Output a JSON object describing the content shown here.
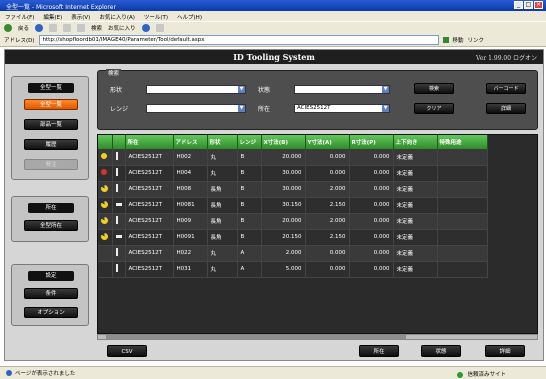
{
  "window": {
    "title": "全型一覧 - Microsoft Internet Explorer"
  },
  "menu": [
    "ファイル(F)",
    "編集(E)",
    "表示(V)",
    "お気に入り(A)",
    "ツール(T)",
    "ヘルプ(H)"
  ],
  "toolbar": {
    "back": "戻る",
    "search": "検索",
    "favorites": "お気に入り"
  },
  "address": {
    "label": "アドレス(D)",
    "url": "http://shopfloordb01/IMAGE40/Parameter/Tool/default.aspx",
    "go": "移動",
    "links": "リンク"
  },
  "app": {
    "title": "ID Tooling System",
    "version": "Ver 1.99.00",
    "logout": "ログオン"
  },
  "left": {
    "panel1": {
      "top": "全型一覧",
      "items": [
        "全型一覧",
        "部品一覧",
        "履歴",
        "発注"
      ]
    },
    "panel2": {
      "head": "所在",
      "item": "全型所在"
    },
    "panel3": {
      "head": "設定",
      "items": [
        "条件",
        "オプション"
      ]
    }
  },
  "search": {
    "legend": "検索",
    "shape_label": "形状",
    "shape_value": "",
    "state_label": "状態",
    "state_value": "",
    "range_label": "レンジ",
    "range_value": "",
    "location_label": "所在",
    "location_value": "ACIES2512T",
    "btn_search": "検索",
    "btn_barcode": "バーコード",
    "btn_clear": "クリア",
    "btn_detail": "詳細"
  },
  "table": {
    "headers": [
      "",
      "",
      "所在",
      "アドレス",
      "形状",
      "レンジ",
      "X寸法(B)",
      "Y寸法(A)",
      "R寸法(P)",
      "上下向き",
      "特殊用途"
    ],
    "rows": [
      {
        "status": "dot",
        "tool": "t",
        "loc": "ACIES2512T",
        "addr": "H002",
        "shape": "丸",
        "range": "B",
        "x": "20.000",
        "y": "0.000",
        "r": "0.000",
        "ud": "未定義",
        "sp": ""
      },
      {
        "status": "red",
        "tool": "t",
        "loc": "ACIES2512T",
        "addr": "H004",
        "shape": "丸",
        "range": "B",
        "x": "30.000",
        "y": "0.000",
        "r": "0.000",
        "ud": "未定義",
        "sp": ""
      },
      {
        "status": "pac",
        "tool": "t",
        "loc": "ACIES2512T",
        "addr": "H008",
        "shape": "長角",
        "range": "B",
        "x": "30.000",
        "y": "2.000",
        "r": "0.000",
        "ud": "未定義",
        "sp": ""
      },
      {
        "status": "pac",
        "tool": "flat",
        "loc": "ACIES2512T",
        "addr": "H0081",
        "shape": "長角",
        "range": "B",
        "x": "30.150",
        "y": "2.150",
        "r": "0.000",
        "ud": "未定義",
        "sp": ""
      },
      {
        "status": "pac",
        "tool": "t",
        "loc": "ACIES2512T",
        "addr": "H009",
        "shape": "長角",
        "range": "B",
        "x": "20.000",
        "y": "2.000",
        "r": "0.000",
        "ud": "未定義",
        "sp": ""
      },
      {
        "status": "pac",
        "tool": "flat",
        "loc": "ACIES2512T",
        "addr": "H0091",
        "shape": "長角",
        "range": "B",
        "x": "20.150",
        "y": "2.150",
        "r": "0.000",
        "ud": "未定義",
        "sp": ""
      },
      {
        "status": "",
        "tool": "t",
        "loc": "ACIES2512T",
        "addr": "H022",
        "shape": "丸",
        "range": "A",
        "x": "2.000",
        "y": "0.000",
        "r": "0.000",
        "ud": "未定義",
        "sp": ""
      },
      {
        "status": "",
        "tool": "t",
        "loc": "ACIES2512T",
        "addr": "H031",
        "shape": "丸",
        "range": "A",
        "x": "5.000",
        "y": "0.000",
        "r": "0.000",
        "ud": "未定義",
        "sp": ""
      }
    ]
  },
  "bottom": {
    "csv": "CSV",
    "location": "所在",
    "status": "状態",
    "detail": "詳細"
  },
  "status": {
    "text": "ページが表示されました",
    "zone": "信頼済みサイト"
  }
}
